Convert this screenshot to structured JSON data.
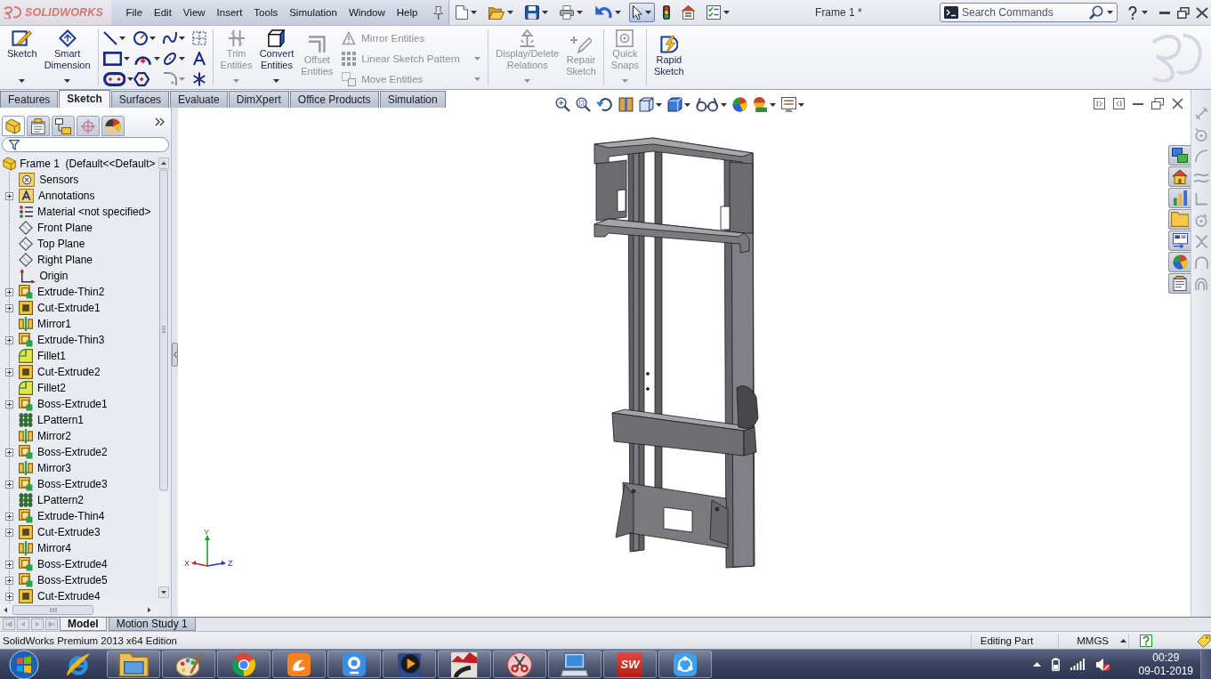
{
  "title_bar": {
    "logo": "SOLIDWORKS",
    "menu": [
      "File",
      "Edit",
      "View",
      "Insert",
      "Tools",
      "Simulation",
      "Window",
      "Help"
    ],
    "quick_access": [
      {
        "kind": "new",
        "dropdown": true,
        "pressed": false
      },
      {
        "kind": "open",
        "dropdown": true,
        "pressed": false
      },
      {
        "kind": "save",
        "dropdown": true,
        "pressed": false
      },
      {
        "kind": "print",
        "dropdown": true,
        "pressed": false
      },
      {
        "kind": "undo",
        "dropdown": true,
        "pressed": false
      },
      {
        "kind": "select",
        "dropdown": true,
        "pressed": true
      },
      {
        "kind": "rebuild",
        "dropdown": false,
        "pressed": false
      },
      {
        "kind": "options",
        "dropdown": false,
        "pressed": false
      },
      {
        "kind": "properties",
        "dropdown": true,
        "pressed": false
      }
    ],
    "document_title": "Frame 1 *",
    "search": {
      "placeholder": "Search Commands"
    }
  },
  "command_manager": {
    "groups": [
      {
        "kind": "large",
        "buttons": [
          {
            "kind": "sketch",
            "label": "Sketch",
            "disabled": false,
            "dropdown": true
          },
          {
            "kind": "dimension",
            "label": "Smart Dimension",
            "disabled": false,
            "dropdown": true
          }
        ]
      },
      {
        "kind": "tools",
        "tools": [
          {
            "kind": "line",
            "dropdown": true,
            "disabled": false
          },
          {
            "kind": "circle",
            "dropdown": true,
            "disabled": false
          },
          {
            "kind": "spline",
            "dropdown": true,
            "disabled": false
          },
          {
            "kind": "construction",
            "dropdown": false,
            "disabled": false
          },
          {
            "kind": "rectangle",
            "dropdown": true,
            "disabled": false
          },
          {
            "kind": "arc",
            "dropdown": true,
            "disabled": false
          },
          {
            "kind": "ellipse",
            "dropdown": true,
            "disabled": false
          },
          {
            "kind": "text",
            "dropdown": false,
            "disabled": false
          },
          {
            "kind": "slot",
            "dropdown": true,
            "disabled": false
          },
          {
            "kind": "polygon",
            "dropdown": false,
            "disabled": false
          },
          {
            "kind": "fillet",
            "dropdown": true,
            "disabled": true
          },
          {
            "kind": "point",
            "dropdown": false,
            "disabled": false
          }
        ]
      },
      {
        "kind": "large",
        "buttons": [
          {
            "kind": "trim",
            "label": "Trim Entities",
            "disabled": true,
            "dropdown": true
          },
          {
            "kind": "convert",
            "label": "Convert Entities",
            "disabled": false,
            "dropdown": true
          },
          {
            "kind": "offset",
            "label": "Offset Entities",
            "disabled": true,
            "dropdown": false
          }
        ],
        "list": [
          {
            "kind": "mirror",
            "label": "Mirror Entities",
            "disabled": true,
            "dropdown": false
          },
          {
            "kind": "pattern",
            "label": "Linear Sketch Pattern",
            "disabled": true,
            "dropdown": true
          },
          {
            "kind": "move",
            "label": "Move Entities",
            "disabled": true,
            "dropdown": true
          }
        ]
      },
      {
        "kind": "large",
        "buttons": [
          {
            "kind": "relations",
            "label": "Display/Delete Relations",
            "disabled": true,
            "dropdown": true
          },
          {
            "kind": "repair",
            "label": "Repair Sketch",
            "disabled": true,
            "dropdown": false
          }
        ]
      },
      {
        "kind": "large",
        "buttons": [
          {
            "kind": "snaps",
            "label": "Quick Snaps",
            "disabled": true,
            "dropdown": true
          }
        ]
      },
      {
        "kind": "large",
        "buttons": [
          {
            "kind": "rapid",
            "label": "Rapid Sketch",
            "disabled": false,
            "dropdown": false
          }
        ]
      }
    ]
  },
  "tabs": [
    {
      "label": "Features",
      "selected": false
    },
    {
      "label": "Sketch",
      "selected": true
    },
    {
      "label": "Surfaces",
      "selected": false
    },
    {
      "label": "Evaluate",
      "selected": false
    },
    {
      "label": "DimXpert",
      "selected": false
    },
    {
      "label": "Office Products",
      "selected": false
    },
    {
      "label": "Simulation",
      "selected": false
    }
  ],
  "feature_manager": {
    "panel_tabs": [
      {
        "kind": "feature_tree",
        "selected": true
      },
      {
        "kind": "property",
        "selected": false
      },
      {
        "kind": "configuration",
        "selected": false
      },
      {
        "kind": "dimxpert",
        "selected": false
      },
      {
        "kind": "display",
        "selected": false
      }
    ],
    "tree": {
      "label": "Frame 1  (Default<<Default>",
      "kind": "part",
      "children": [
        {
          "label": "Sensors",
          "kind": "sensors",
          "expandable": false
        },
        {
          "label": "Annotations",
          "kind": "annotations",
          "expandable": true
        },
        {
          "label": "Material <not specified>",
          "kind": "material",
          "expandable": false
        },
        {
          "label": "Front Plane",
          "kind": "plane",
          "expandable": false
        },
        {
          "label": "Top Plane",
          "kind": "plane",
          "expandable": false
        },
        {
          "label": "Right Plane",
          "kind": "plane",
          "expandable": false
        },
        {
          "label": "Origin",
          "kind": "origin",
          "expandable": false
        },
        {
          "label": "Extrude-Thin2",
          "kind": "extrude",
          "expandable": true
        },
        {
          "label": "Cut-Extrude1",
          "kind": "cut",
          "expandable": true
        },
        {
          "label": "Mirror1",
          "kind": "mirror",
          "expandable": false
        },
        {
          "label": "Extrude-Thin3",
          "kind": "extrude",
          "expandable": true
        },
        {
          "label": "Fillet1",
          "kind": "fillet",
          "expandable": false
        },
        {
          "label": "Cut-Extrude2",
          "kind": "cut",
          "expandable": true
        },
        {
          "label": "Fillet2",
          "kind": "fillet",
          "expandable": false
        },
        {
          "label": "Boss-Extrude1",
          "kind": "extrude",
          "expandable": true
        },
        {
          "label": "LPattern1",
          "kind": "pattern",
          "expandable": false
        },
        {
          "label": "Mirror2",
          "kind": "mirror",
          "expandable": false
        },
        {
          "label": "Boss-Extrude2",
          "kind": "extrude",
          "expandable": true
        },
        {
          "label": "Mirror3",
          "kind": "mirror",
          "expandable": false
        },
        {
          "label": "Boss-Extrude3",
          "kind": "extrude",
          "expandable": true
        },
        {
          "label": "LPattern2",
          "kind": "pattern",
          "expandable": false
        },
        {
          "label": "Extrude-Thin4",
          "kind": "extrude",
          "expandable": true
        },
        {
          "label": "Cut-Extrude3",
          "kind": "cut",
          "expandable": true
        },
        {
          "label": "Mirror4",
          "kind": "mirror",
          "expandable": false
        },
        {
          "label": "Boss-Extrude4",
          "kind": "extrude",
          "expandable": true
        },
        {
          "label": "Boss-Extrude5",
          "kind": "extrude",
          "expandable": true
        },
        {
          "label": "Cut-Extrude4",
          "kind": "cut",
          "expandable": true
        }
      ]
    }
  },
  "viewport": {
    "triad_labels": {
      "y": "Y",
      "x": "X",
      "z": "Z"
    }
  },
  "bottom_tabs": [
    {
      "label": "Model",
      "selected": true
    },
    {
      "label": "Motion Study 1",
      "selected": false
    }
  ],
  "status_bar": {
    "edition": "SolidWorks Premium 2013 x64 Edition",
    "mode": "Editing Part",
    "units": "MMGS"
  },
  "taskbar": {
    "apps": [
      {
        "kind": "e_logo",
        "running": false
      },
      {
        "kind": "folder",
        "running": true
      },
      {
        "kind": "palette",
        "running": true
      },
      {
        "kind": "wheel",
        "running": true
      },
      {
        "kind": "app_tile",
        "running": true
      },
      {
        "kind": "webcam",
        "running": true
      },
      {
        "kind": "media",
        "running": true
      },
      {
        "kind": "road",
        "running": true
      },
      {
        "kind": "scissors",
        "running": true
      },
      {
        "kind": "computer",
        "running": true
      },
      {
        "kind": "logo_tile",
        "running": true,
        "logo_text": "SW"
      },
      {
        "kind": "share",
        "running": true
      }
    ],
    "clock": {
      "time": "00:29",
      "date": "09-01-2019"
    }
  }
}
